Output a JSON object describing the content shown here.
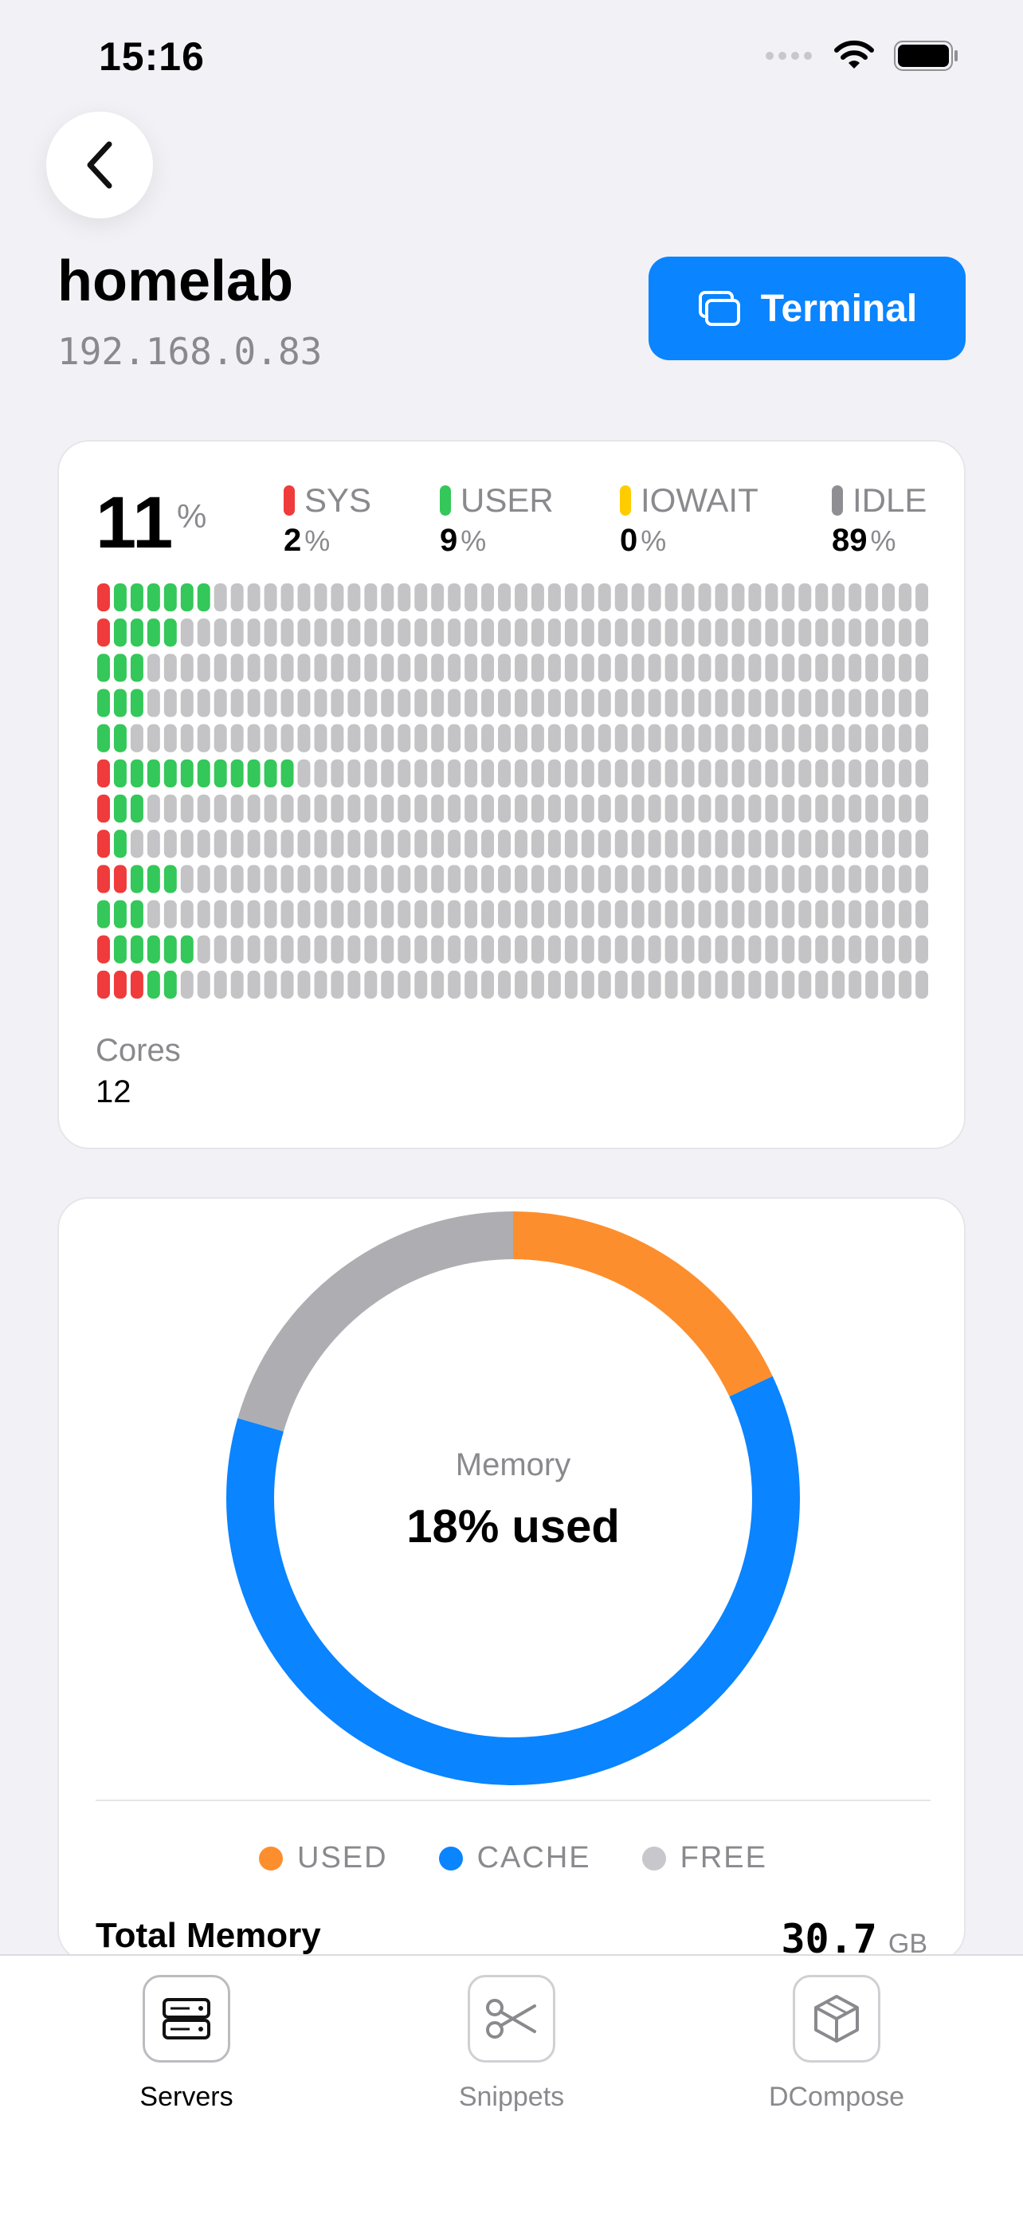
{
  "status_bar": {
    "time": "15:16"
  },
  "header": {
    "host_name": "homelab",
    "host_ip": "192.168.0.83",
    "terminal_label": "Terminal"
  },
  "cpu": {
    "total": "11",
    "total_unit": "%",
    "stats": [
      {
        "label": "SYS",
        "value": "2",
        "unit": "%",
        "color": "#ef3b3b"
      },
      {
        "label": "USER",
        "value": "9",
        "unit": "%",
        "color": "#34c759"
      },
      {
        "label": "IOWAIT",
        "value": "0",
        "unit": "%",
        "color": "#ffcc00"
      },
      {
        "label": "IDLE",
        "value": "89",
        "unit": "%",
        "color": "#8e8e93"
      }
    ],
    "cores_label": "Cores",
    "cores_value": "12",
    "core_usage": [
      {
        "sys": 1,
        "user": 6
      },
      {
        "sys": 1,
        "user": 4
      },
      {
        "sys": 0,
        "user": 3
      },
      {
        "sys": 0,
        "user": 3
      },
      {
        "sys": 0,
        "user": 2
      },
      {
        "sys": 1,
        "user": 11
      },
      {
        "sys": 1,
        "user": 2
      },
      {
        "sys": 1,
        "user": 1
      },
      {
        "sys": 2,
        "user": 3
      },
      {
        "sys": 0,
        "user": 3
      },
      {
        "sys": 1,
        "user": 5
      },
      {
        "sys": 3,
        "user": 2
      }
    ],
    "segments_per_core": 50,
    "colors": {
      "sys": "#ef3b3b",
      "user": "#34c759",
      "idle": "#c4c4c7"
    }
  },
  "memory": {
    "label": "Memory",
    "used_text": "18% used",
    "segments": [
      {
        "name": "used",
        "fraction": 0.18,
        "color": "#fd8e2d"
      },
      {
        "name": "cache",
        "fraction": 0.615,
        "color": "#0a84ff"
      },
      {
        "name": "free",
        "fraction": 0.205,
        "color": "#aeaeb2"
      }
    ],
    "legend": [
      {
        "label": "USED",
        "color": "#fd8e2d"
      },
      {
        "label": "CACHE",
        "color": "#0a84ff"
      },
      {
        "label": "FREE",
        "color": "#c7c7cc"
      }
    ],
    "total_label": "Total Memory",
    "total_value": "30.7",
    "total_unit": "GB"
  },
  "tabs": [
    {
      "label": "Servers",
      "icon": "server-icon",
      "active": true
    },
    {
      "label": "Snippets",
      "icon": "scissors-icon",
      "active": false
    },
    {
      "label": "DCompose",
      "icon": "box-icon",
      "active": false
    }
  ]
}
